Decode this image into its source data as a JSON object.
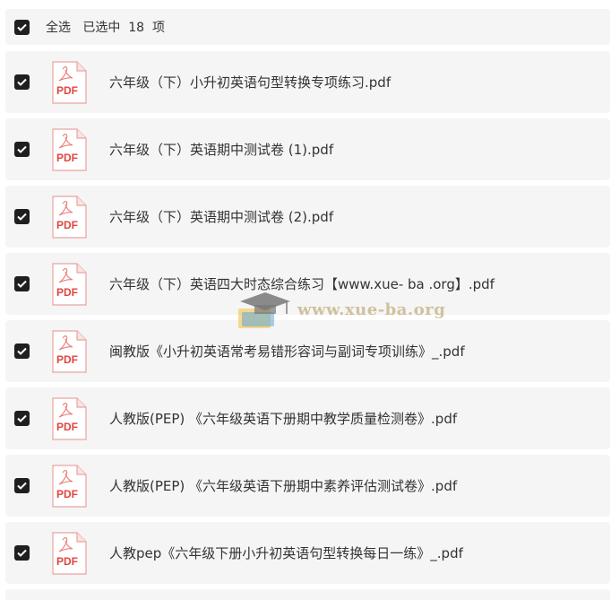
{
  "header": {
    "select_all_label": "全选   已选中  18  项"
  },
  "files": [
    {
      "name": "六年级（下）小升初英语句型转换专项练习.pdf"
    },
    {
      "name": "六年级（下）英语期中测试卷 (1).pdf"
    },
    {
      "name": "六年级（下）英语期中测试卷 (2).pdf"
    },
    {
      "name": "六年级（下）英语四大时态综合练习【www.xue- ba .org】.pdf"
    },
    {
      "name": "闽教版《小升初英语常考易错形容词与副词专项训练》_.pdf"
    },
    {
      "name": "人教版(PEP) 《六年级英语下册期中教学质量检测卷》.pdf"
    },
    {
      "name": "人教版(PEP) 《六年级英语下册期中素养评估测试卷》.pdf"
    },
    {
      "name": "人教pep《六年级下册小升初英语句型转换每日一练》_.pdf"
    }
  ],
  "icons": {
    "checkbox": "checkbox-checked-icon",
    "file": "pdf-file-icon",
    "pdf_label": "PDF"
  },
  "watermark": {
    "text": "www.xue-ba.org"
  },
  "colors": {
    "row_bg": "#f5f5f5",
    "checkbox": "#1f1f1f",
    "pdf_red": "#e0453f"
  }
}
